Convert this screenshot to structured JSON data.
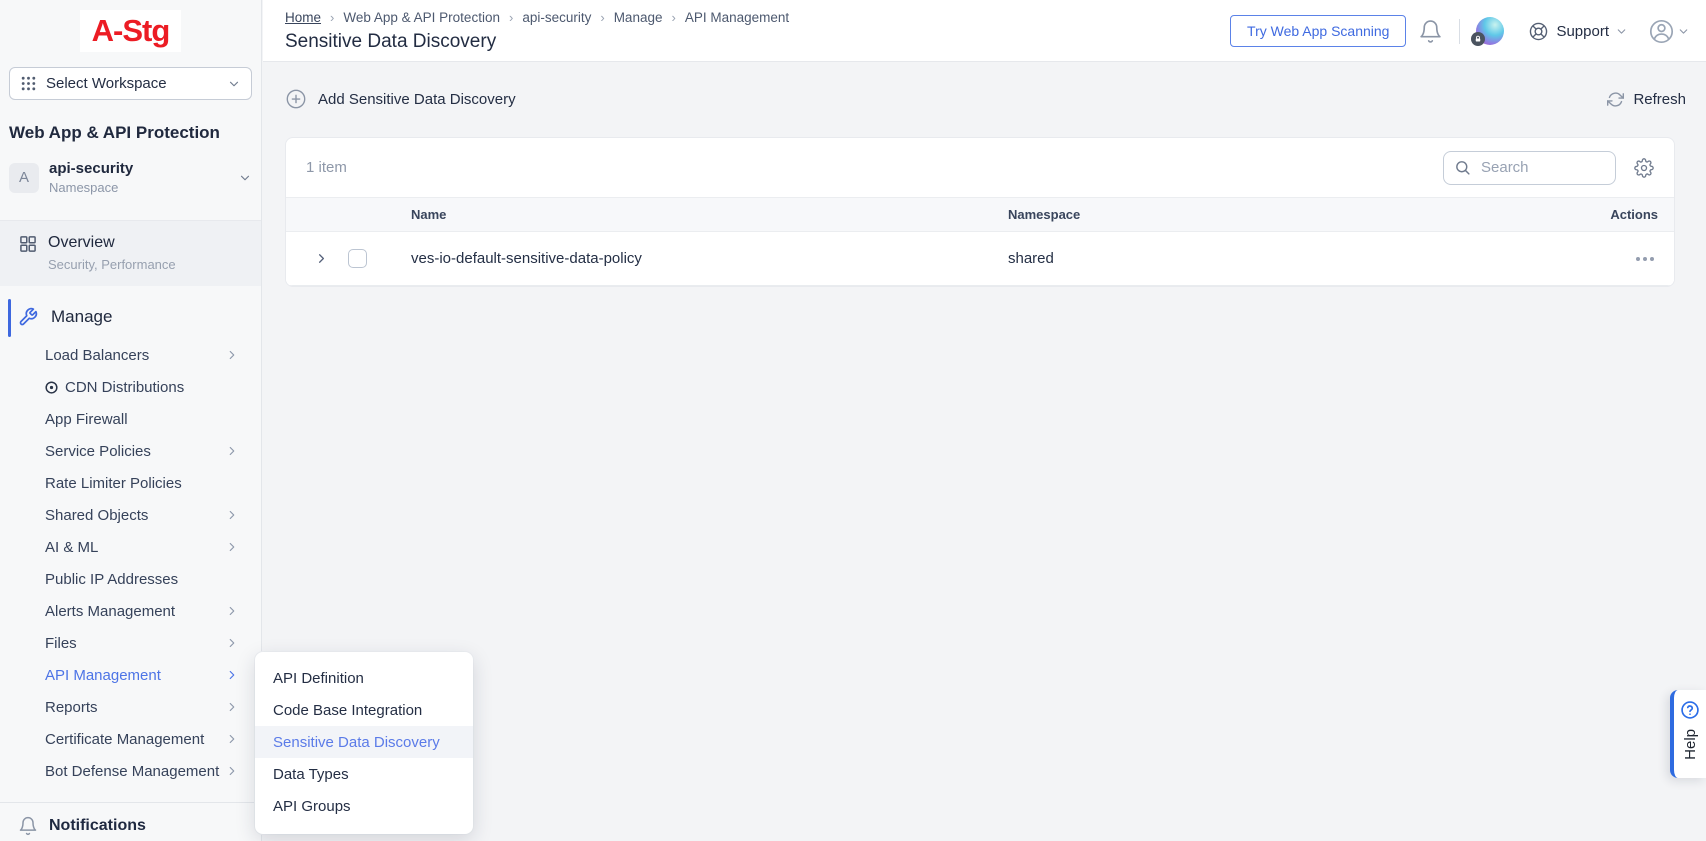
{
  "app": {
    "logo": "A-Stg"
  },
  "colors": {
    "accent_blue": "#3f6ae0",
    "logo_red": "#ec1c24",
    "flyout_active_blue": "#5b7be8",
    "dark_navy": "#222c42",
    "help_border_blue": "#2e6be0",
    "active_nav_blue": "#4d74e6"
  },
  "icons": [
    "grid-dots-icon",
    "chevron-down-icon",
    "grid-icon",
    "wrench-icon",
    "bullseye-icon",
    "chevron-right-icon",
    "bell-icon",
    "lock-badge-icon",
    "lifebuoy-icon",
    "user-circle-icon",
    "plus-circle-icon",
    "refresh-icon",
    "search-icon",
    "gear-icon",
    "help-circle-icon",
    "ellipsis-icon"
  ],
  "sidebar": {
    "workspace_label": "Select Workspace",
    "section_title": "Web App & API Protection",
    "namespace": {
      "initial": "A",
      "name": "api-security",
      "type_label": "Namespace"
    },
    "overview": {
      "label": "Overview",
      "sublabel": "Security, Performance"
    },
    "manage_label": "Manage",
    "items": [
      {
        "label": "Load Balancers",
        "chevron": true
      },
      {
        "label": "CDN Distributions",
        "icon": "bullseye-icon"
      },
      {
        "label": "App Firewall"
      },
      {
        "label": "Service Policies",
        "chevron": true
      },
      {
        "label": "Rate Limiter Policies"
      },
      {
        "label": "Shared Objects",
        "chevron": true
      },
      {
        "label": "AI & ML",
        "chevron": true
      },
      {
        "label": "Public IP Addresses"
      },
      {
        "label": "Alerts Management",
        "chevron": true
      },
      {
        "label": "Files",
        "chevron": true
      },
      {
        "label": "API Management",
        "chevron": true,
        "active": true
      },
      {
        "label": "Reports",
        "chevron": true
      },
      {
        "label": "Certificate Management",
        "chevron": true
      },
      {
        "label": "Bot Defense Management",
        "chevron": true
      }
    ],
    "notifications_label": "Notifications"
  },
  "flyout": {
    "items": [
      {
        "label": "API Definition"
      },
      {
        "label": "Code Base Integration"
      },
      {
        "label": "Sensitive Data Discovery",
        "active": true
      },
      {
        "label": "Data Types"
      },
      {
        "label": "API Groups"
      }
    ]
  },
  "header": {
    "breadcrumb": [
      "Home",
      "Web App & API Protection",
      "api-security",
      "Manage",
      "API Management"
    ],
    "title": "Sensitive Data Discovery",
    "try_button_label": "Try Web App Scanning",
    "support_label": "Support"
  },
  "toolbar": {
    "add_label": "Add Sensitive Data Discovery",
    "refresh_label": "Refresh"
  },
  "table": {
    "count_label": "1 item",
    "search_placeholder": "Search",
    "columns": [
      "Name",
      "Namespace",
      "Actions"
    ],
    "rows": [
      {
        "name": "ves-io-default-sensitive-data-policy",
        "namespace": "shared"
      }
    ]
  },
  "help": {
    "label": "Help"
  }
}
